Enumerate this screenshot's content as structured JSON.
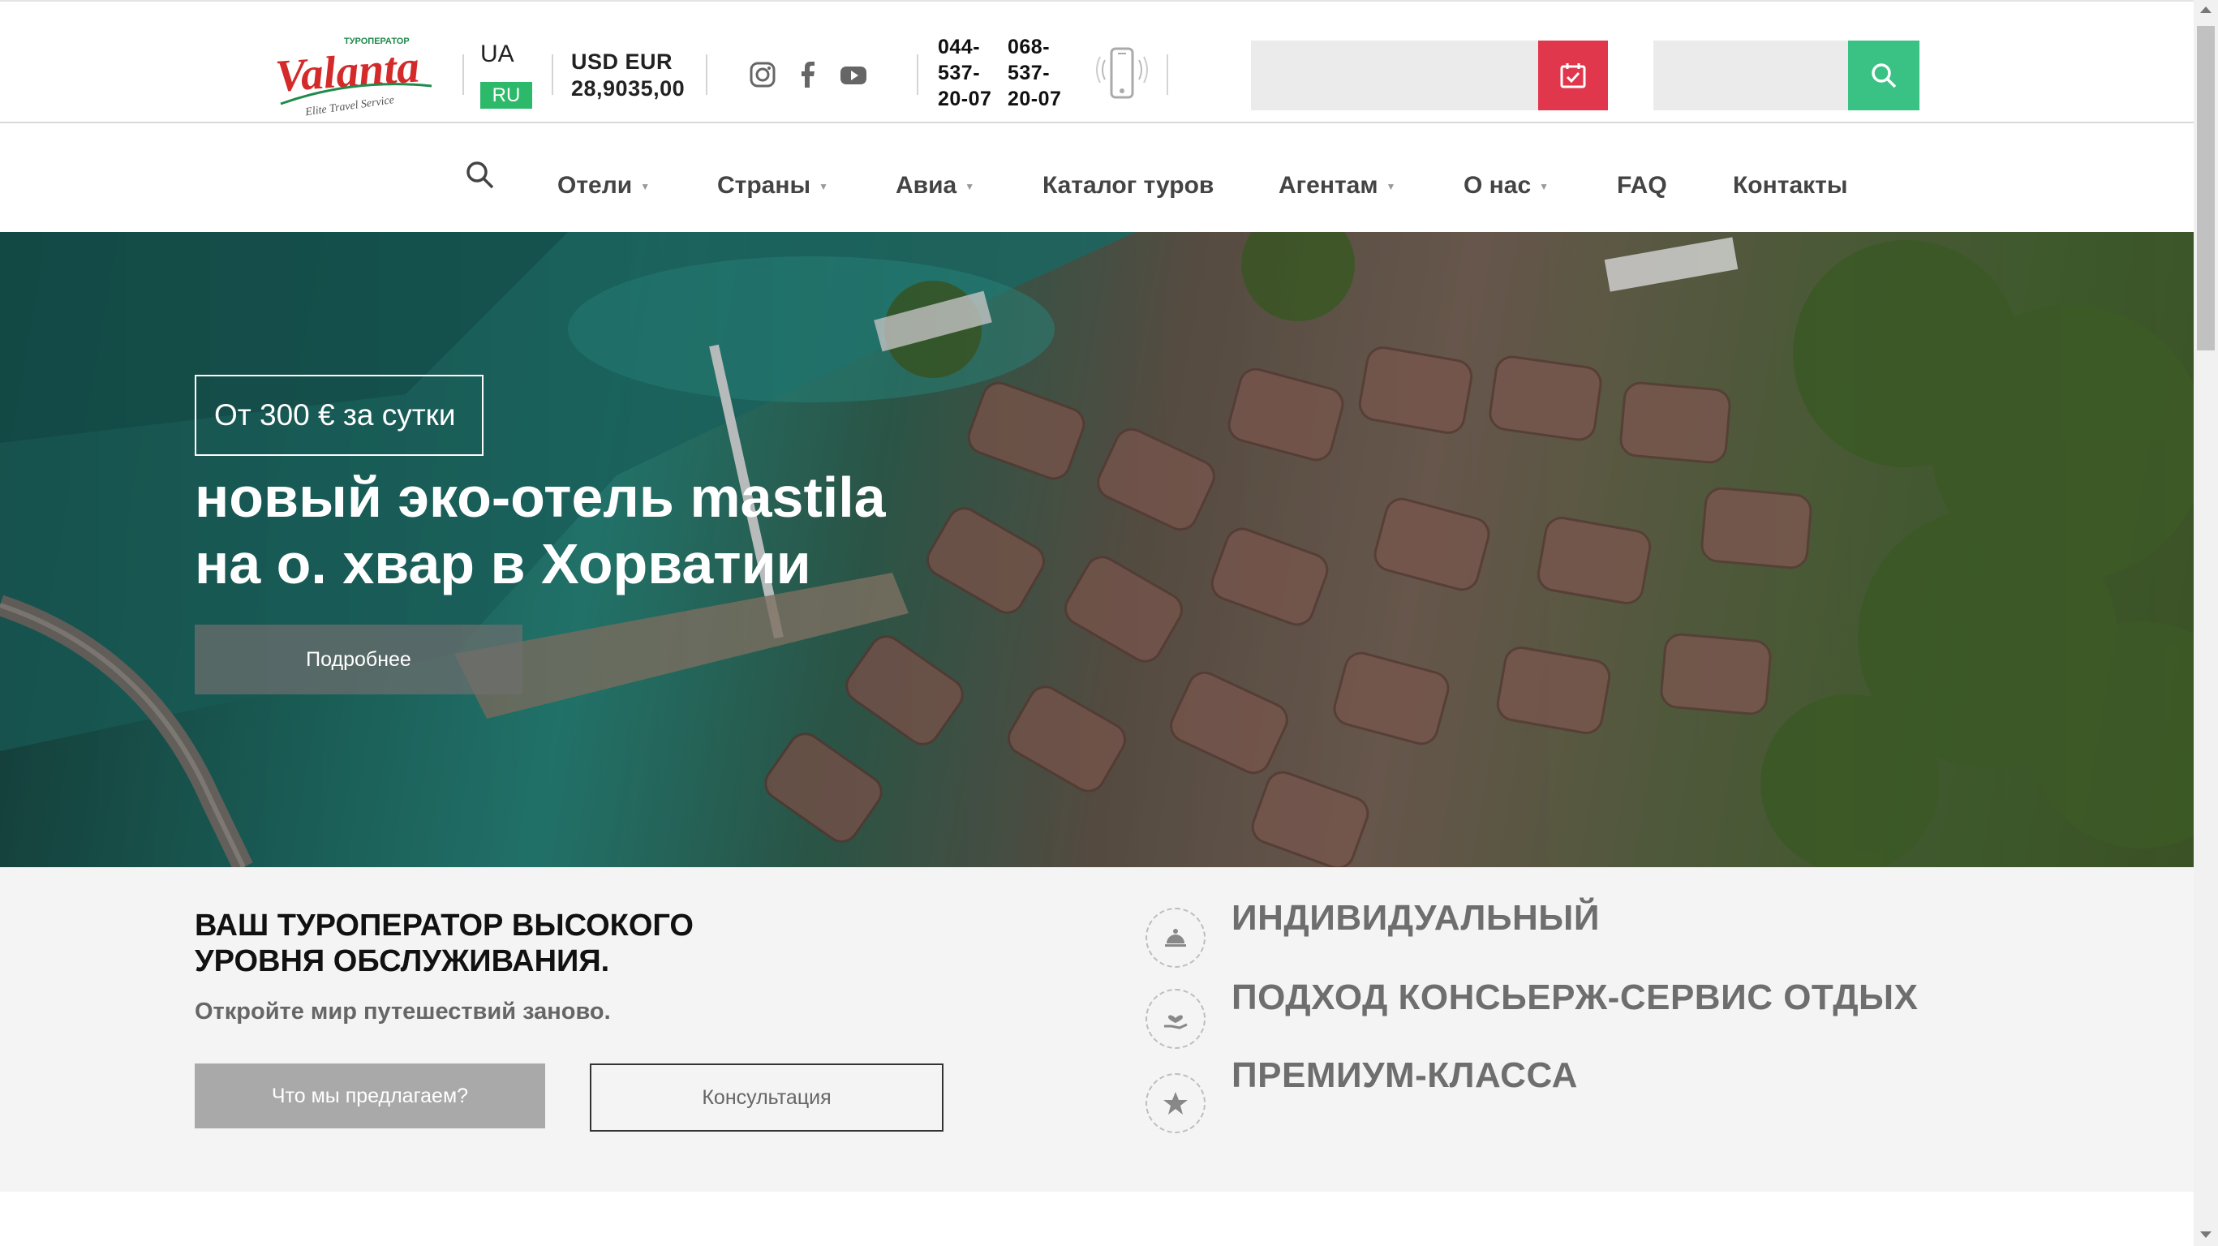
{
  "header": {
    "logo": {
      "brand": "Valanta",
      "top_line": "ТУРОПЕРАТОР",
      "tagline": "Elite Travel Service"
    },
    "languages": [
      "UA",
      "RU"
    ],
    "active_language": "RU",
    "currency": {
      "label": "USD EUR",
      "value": "28,9035,00"
    },
    "social": [
      "instagram-icon",
      "facebook-icon",
      "youtube-icon"
    ],
    "phones": [
      "044-\n537-\n20-07",
      "068-\n537-\n20-07"
    ],
    "search_placeholder": "",
    "search2_placeholder": "",
    "accent_red": "#e1374c",
    "accent_green": "#3ac184"
  },
  "nav": {
    "items": [
      {
        "label": "Отели",
        "dropdown": true
      },
      {
        "label": "Страны",
        "dropdown": true
      },
      {
        "label": "Авиа",
        "dropdown": true
      },
      {
        "label": "Каталог туров",
        "dropdown": false
      },
      {
        "label": "Агентам",
        "dropdown": true
      },
      {
        "label": "О нас",
        "dropdown": true
      },
      {
        "label": "FAQ",
        "dropdown": false
      },
      {
        "label": "Контакты",
        "dropdown": false
      }
    ]
  },
  "hero": {
    "badge": "От 300 € за сутки",
    "title_line1": "новый эко-отель mastila",
    "title_line2": "на о. хвар в Хорватии",
    "button": "Подробнее"
  },
  "info": {
    "title": "ВАШ ТУРОПЕРАТОР ВЫСОКОГО\nУРОВНЯ ОБСЛУЖИВАНИЯ.",
    "subtitle": "Откройте мир путешествий заново.",
    "btn_offer": "Что мы предлагаем?",
    "btn_consult": "Консультация",
    "features": [
      {
        "icon": "concierge-icon",
        "text": "ИНДИВИДУАЛЬНЫЙ"
      },
      {
        "icon": "hand-heart-icon",
        "text": "ПОДХОД КОНСЬЕРЖ-СЕРВИС ОТДЫХ"
      },
      {
        "icon": "star-icon",
        "text": "ПРЕМИУМ-КЛАССА"
      }
    ]
  }
}
